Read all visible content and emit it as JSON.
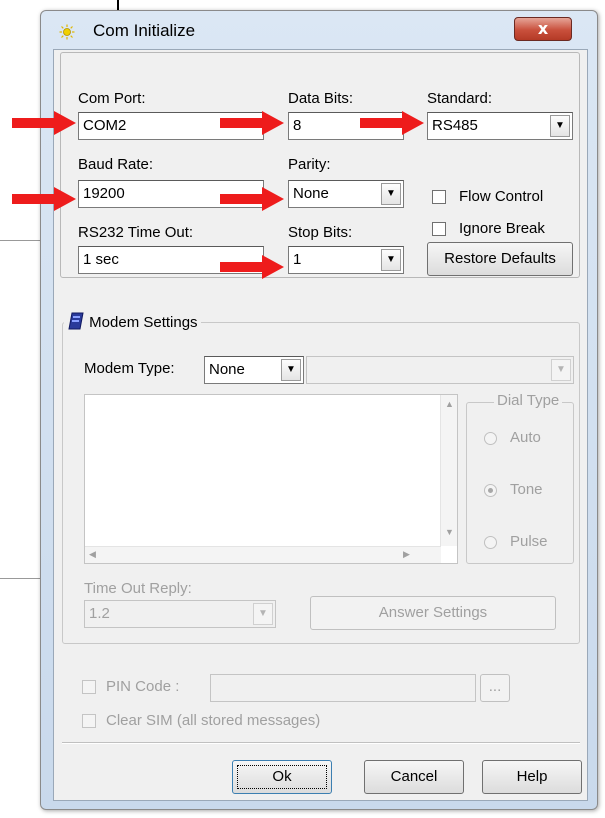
{
  "window": {
    "title": "Com Initialize",
    "close_glyph": "x"
  },
  "com_port": {
    "label": "Com Port:",
    "value": "COM2"
  },
  "data_bits": {
    "label": "Data Bits:",
    "value": "8"
  },
  "standard": {
    "label": "Standard:",
    "value": "RS485"
  },
  "baud_rate": {
    "label": "Baud Rate:",
    "value": "19200"
  },
  "parity": {
    "label": "Parity:",
    "value": "None"
  },
  "flow_control": {
    "label": "Flow Control",
    "checked": false
  },
  "ignore_break": {
    "label": "Ignore Break",
    "checked": false
  },
  "rs232_timeout": {
    "label": "RS232 Time Out:",
    "value": "1 sec"
  },
  "stop_bits": {
    "label": "Stop Bits:",
    "value": "1"
  },
  "restore_defaults": {
    "label": "Restore Defaults"
  },
  "modem": {
    "group_label": "Modem Settings",
    "type_label": "Modem Type:",
    "type_value": "None",
    "model_value": "",
    "dial_type": {
      "label": "Dial Type",
      "options": [
        "Auto",
        "Tone",
        "Pulse"
      ],
      "selected": "Tone"
    },
    "timeout_reply_label": "Time Out Reply:",
    "timeout_reply_value": "1.2",
    "answer_settings_label": "Answer Settings"
  },
  "pin_code": {
    "label": "PIN Code :",
    "value": "",
    "browse_label": "..."
  },
  "clear_sim": {
    "label": "Clear SIM (all stored messages)"
  },
  "buttons": {
    "ok": "Ok",
    "cancel": "Cancel",
    "help": "Help"
  },
  "colors": {
    "annotation_arrow": "#ee1c1c",
    "close_button": "#c9503c",
    "title_gradient": "#dbe7f4"
  },
  "icons": {
    "title": "sun-icon",
    "modem": "modem-icon"
  }
}
